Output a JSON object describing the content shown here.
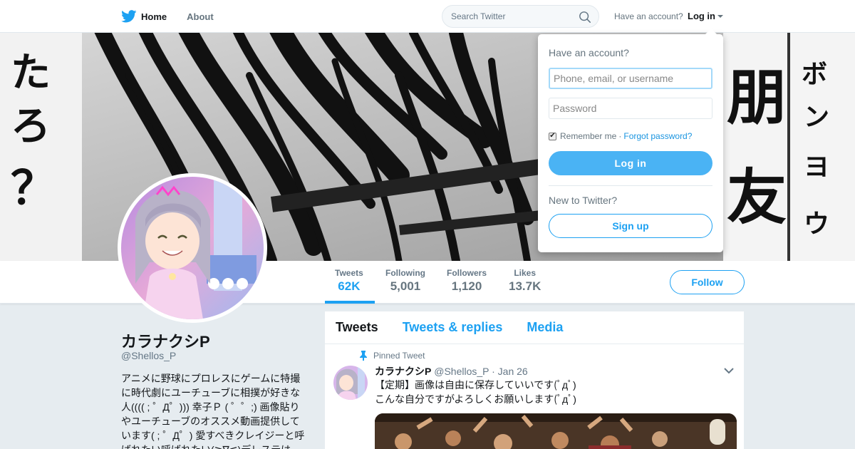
{
  "nav": {
    "home_label": "Home",
    "about_label": "About",
    "search_placeholder": "Search Twitter",
    "have_account": "Have an account?",
    "login_label": "Log in"
  },
  "banner": {
    "left_text": "たろ？",
    "right_text_vertical": "ボンヨウ",
    "right_text_big": "朋友"
  },
  "stats": [
    {
      "label": "Tweets",
      "value": "62K",
      "active": true
    },
    {
      "label": "Following",
      "value": "5,001",
      "active": false
    },
    {
      "label": "Followers",
      "value": "1,120",
      "active": false
    },
    {
      "label": "Likes",
      "value": "13.7K",
      "active": false
    }
  ],
  "follow_label": "Follow",
  "profile": {
    "name": "カラナクシP",
    "handle": "@Shellos_P",
    "bio_lines": [
      "アニメに野球にプロレスにゲームに特撮",
      "に時代劇にユーチューブに相撲が好きな",
      "人(((( ; ゜Д゜))) 幸子Ｐ ( ゜゜;) 画像貼り",
      "やユーチューブのオススメ動画提供して",
      "います( ; ゜Д゜) 愛すべきクレイジーと呼",
      "ばれたい呼ばれたい(≧∇≦)デレステは"
    ]
  },
  "timeline": {
    "tabs": [
      "Tweets",
      "Tweets & replies",
      "Media"
    ],
    "pinned_label": "Pinned Tweet",
    "tweet": {
      "name": "カラナクシP",
      "handle": "@Shellos_P",
      "date": "· Jan 26",
      "line1": "【定期】画像は自由に保存していいです(ﾟдﾟ)",
      "line2": "こんな自分ですがよろしくお願いします(ﾟдﾟ)"
    }
  },
  "dropdown": {
    "title": "Have an account?",
    "username_placeholder": "Phone, email, or username",
    "password_placeholder": "Password",
    "remember_label": "Remember me",
    "separator": "·",
    "forgot_label": "Forgot password?",
    "login_button": "Log in",
    "new_label": "New to Twitter?",
    "signup_button": "Sign up"
  },
  "colors": {
    "brand": "#1da1f2",
    "login_button": "#4ab3f4",
    "background": "#e6ecf0"
  },
  "icons": [
    "twitter-bird-icon",
    "search-icon",
    "pin-icon",
    "chevron-down-icon",
    "checkbox-checked-icon"
  ]
}
